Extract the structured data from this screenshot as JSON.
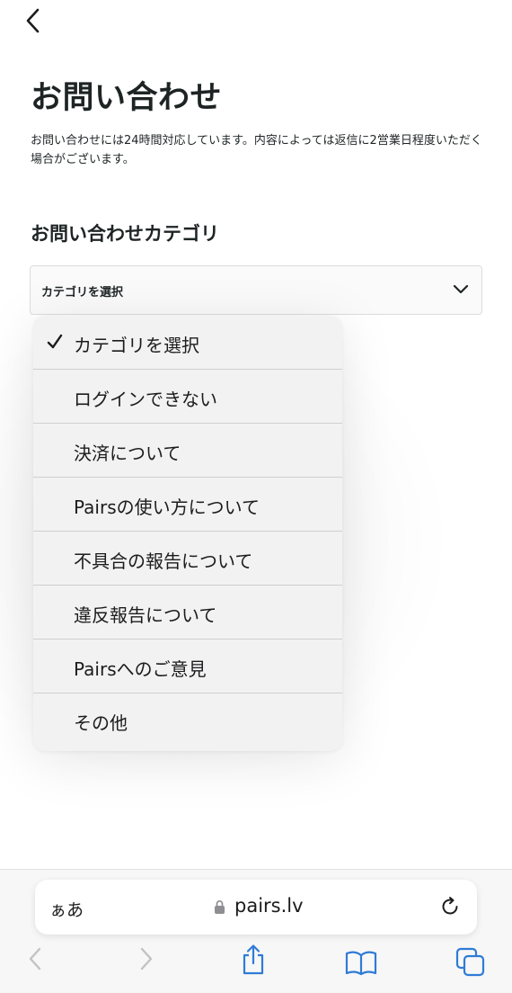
{
  "page": {
    "title": "お問い合わせ",
    "intro": "お問い合わせには24時間対応しています。内容によっては返信に2営業日程度いただく場合がございます。",
    "category_heading": "お問い合わせカテゴリ"
  },
  "select": {
    "value": "カテゴリを選択"
  },
  "dropdown": {
    "items": [
      {
        "label": "カテゴリを選択",
        "checked": true
      },
      {
        "label": "ログインできない",
        "checked": false
      },
      {
        "label": "決済について",
        "checked": false
      },
      {
        "label": "Pairsの使い方について",
        "checked": false
      },
      {
        "label": "不具合の報告について",
        "checked": false
      },
      {
        "label": "違反報告について",
        "checked": false
      },
      {
        "label": "Pairsへのご意見",
        "checked": false
      },
      {
        "label": "その他",
        "checked": false
      }
    ]
  },
  "browser": {
    "aa_label": "ぁあ",
    "url": "pairs.lv",
    "accent_color": "#2f7bd6",
    "disabled_color": "#c2c2c6",
    "toolbar_icons": [
      "back-arrow-icon",
      "forward-arrow-icon",
      "share-icon",
      "bookmarks-icon",
      "tabs-icon"
    ]
  }
}
